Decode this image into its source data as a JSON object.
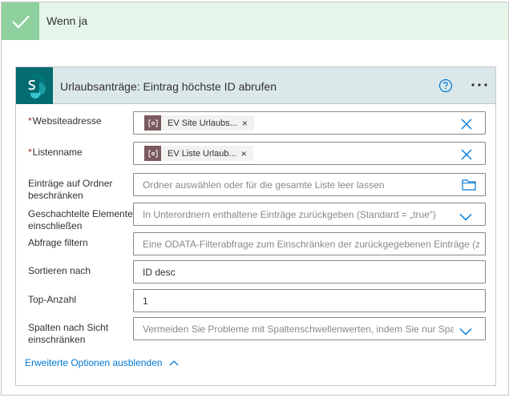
{
  "condition": {
    "title": "Wenn ja"
  },
  "action": {
    "title": "Urlaubsanträge: Eintrag höchste ID abrufen",
    "help_icon": "question-circle-icon",
    "more_icon": "ellipsis-icon"
  },
  "fields": {
    "site": {
      "label": "Websiteadresse",
      "required": "*",
      "token": "EV Site Urlaubs...",
      "token_remove": "×"
    },
    "list": {
      "label": "Listenname",
      "required": "*",
      "token": "EV Liste Urlaub...",
      "token_remove": "×"
    },
    "folder": {
      "label": "Einträge auf Ordner beschränken",
      "placeholder": "Ordner auswählen oder für die gesamte Liste leer lassen"
    },
    "nested": {
      "label": "Geschachtelte Elemente einschließen",
      "placeholder": "In Unterordnern enthaltene Einträge zurückgeben (Standard = „true“)"
    },
    "filter": {
      "label": "Abfrage filtern",
      "placeholder": "Eine ODATA-Filterabfrage zum Einschränken der zurückgegebenen Einträge (z. B"
    },
    "sort": {
      "label": "Sortieren nach",
      "value": "ID desc"
    },
    "top": {
      "label": "Top-Anzahl",
      "value": "1"
    },
    "view": {
      "label": "Spalten nach Sicht einschränken",
      "placeholder": "Vermeiden Sie Probleme mit Spaltenschwellenwerten, indem Sie nur Spal"
    }
  },
  "advanced_toggle": "Erweiterte Optionen ausblenden",
  "colors": {
    "success_header": "#e6f5ea",
    "success_check": "#8fd19e",
    "card_header": "#dbe8ea",
    "sharepoint": "#036c70",
    "token_icon": "#7a5a5e",
    "link": "#0078d4",
    "required": "#a4262c"
  }
}
